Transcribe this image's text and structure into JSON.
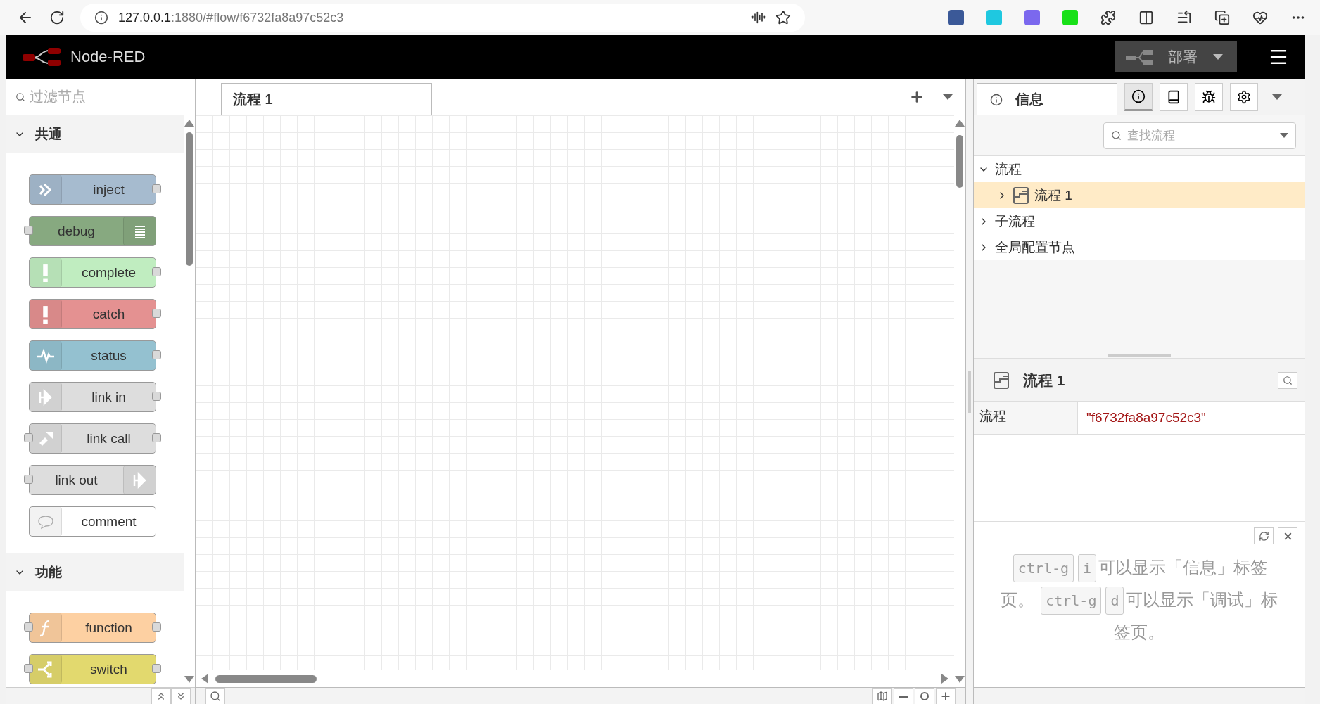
{
  "browser": {
    "url_host": "127.0.0.1",
    "url_path": ":1880/#flow/f6732fa8a97c52c3"
  },
  "header": {
    "title": "Node-RED",
    "deploy": "部署"
  },
  "palette": {
    "filter_placeholder": "过滤节点",
    "categories": [
      {
        "label": "共通",
        "expanded": true,
        "nodes": [
          {
            "kind": "inject",
            "label": "inject",
            "color": "#a6bbcf",
            "input": false,
            "output": true
          },
          {
            "kind": "debug",
            "label": "debug",
            "color": "#87a980",
            "input": true,
            "output": false
          },
          {
            "kind": "complete",
            "label": "complete",
            "color": "#c0edc0",
            "input": false,
            "output": true
          },
          {
            "kind": "catch",
            "label": "catch",
            "color": "#e49191",
            "input": false,
            "output": true
          },
          {
            "kind": "status",
            "label": "status",
            "color": "#94c1d0",
            "input": false,
            "output": true
          },
          {
            "kind": "link-in",
            "label": "link in",
            "color": "#dddddd",
            "input": false,
            "output": true
          },
          {
            "kind": "link-call",
            "label": "link call",
            "color": "#dddddd",
            "input": true,
            "output": true
          },
          {
            "kind": "link-out",
            "label": "link out",
            "color": "#dddddd",
            "input": true,
            "output": false
          },
          {
            "kind": "comment",
            "label": "comment",
            "color": "#ffffff",
            "input": false,
            "output": false
          }
        ]
      },
      {
        "label": "功能",
        "expanded": true,
        "nodes": [
          {
            "kind": "function",
            "label": "function",
            "color": "#fdd0a2",
            "input": true,
            "output": true
          },
          {
            "kind": "switch",
            "label": "switch",
            "color": "#e2d96e",
            "input": true,
            "output": true
          }
        ]
      }
    ]
  },
  "workspace": {
    "tabs": [
      {
        "label": "流程 1",
        "selected": true
      }
    ]
  },
  "sidebar": {
    "active_tab": "信息",
    "icon_tabs": [
      {
        "kind": "info",
        "selected": true
      },
      {
        "kind": "book",
        "selected": false
      },
      {
        "kind": "bug",
        "selected": false
      },
      {
        "kind": "gear",
        "selected": false
      }
    ],
    "search_placeholder": "查找流程",
    "tree": [
      {
        "label": "流程",
        "expanded": true,
        "selected": false,
        "children": [
          {
            "label": "流程 1",
            "expanded": false,
            "selected": true
          }
        ]
      },
      {
        "label": "子流程",
        "expanded": false,
        "selected": false
      },
      {
        "label": "全局配置节点",
        "expanded": false,
        "selected": false
      }
    ],
    "info": {
      "title": "流程 1",
      "rows": [
        {
          "label": "流程",
          "value": "\"f6732fa8a97c52c3\""
        }
      ]
    },
    "help": [
      {
        "kind": "key",
        "text": "ctrl-g"
      },
      {
        "kind": "key",
        "text": "i"
      },
      {
        "kind": "text",
        "text": "可以显示「信息」标签页。"
      },
      {
        "kind": "key",
        "text": "ctrl-g"
      },
      {
        "kind": "key",
        "text": "d"
      },
      {
        "kind": "text",
        "text": "可以显示「调试」标签页。"
      }
    ]
  }
}
